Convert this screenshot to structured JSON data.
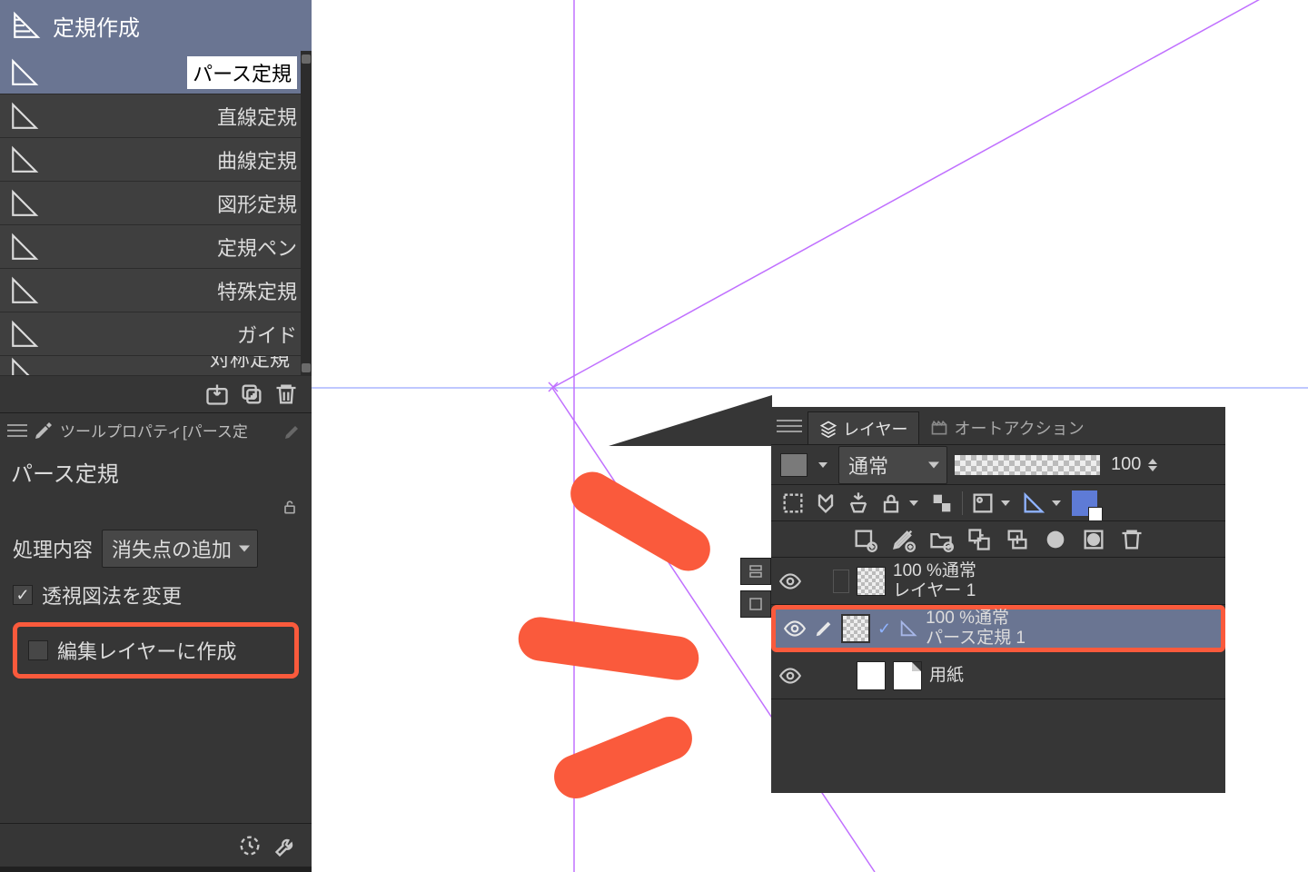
{
  "left": {
    "header": "定規作成",
    "subtools": [
      {
        "label": "パース定規",
        "selected": true
      },
      {
        "label": "直線定規"
      },
      {
        "label": "曲線定規"
      },
      {
        "label": "図形定規"
      },
      {
        "label": "定規ペン"
      },
      {
        "label": "特殊定規"
      },
      {
        "label": "ガイド"
      }
    ],
    "peek_label": "対称定規",
    "prop_header": "ツールプロパティ[パース定",
    "prop_title": "パース定規",
    "process_label": "処理内容",
    "process_value": "消失点の追加",
    "chk1_label": "透視図法を変更",
    "chk2_label": "編集レイヤーに作成"
  },
  "layers": {
    "tab_layer": "レイヤー",
    "tab_action": "オートアクション",
    "blend_mode": "通常",
    "opacity": "100",
    "rows": [
      {
        "top": "100 %通常",
        "bottom": "レイヤー 1"
      },
      {
        "top": "100 %通常",
        "bottom": "パース定規 1"
      },
      {
        "top": "",
        "bottom": "用紙"
      }
    ]
  }
}
